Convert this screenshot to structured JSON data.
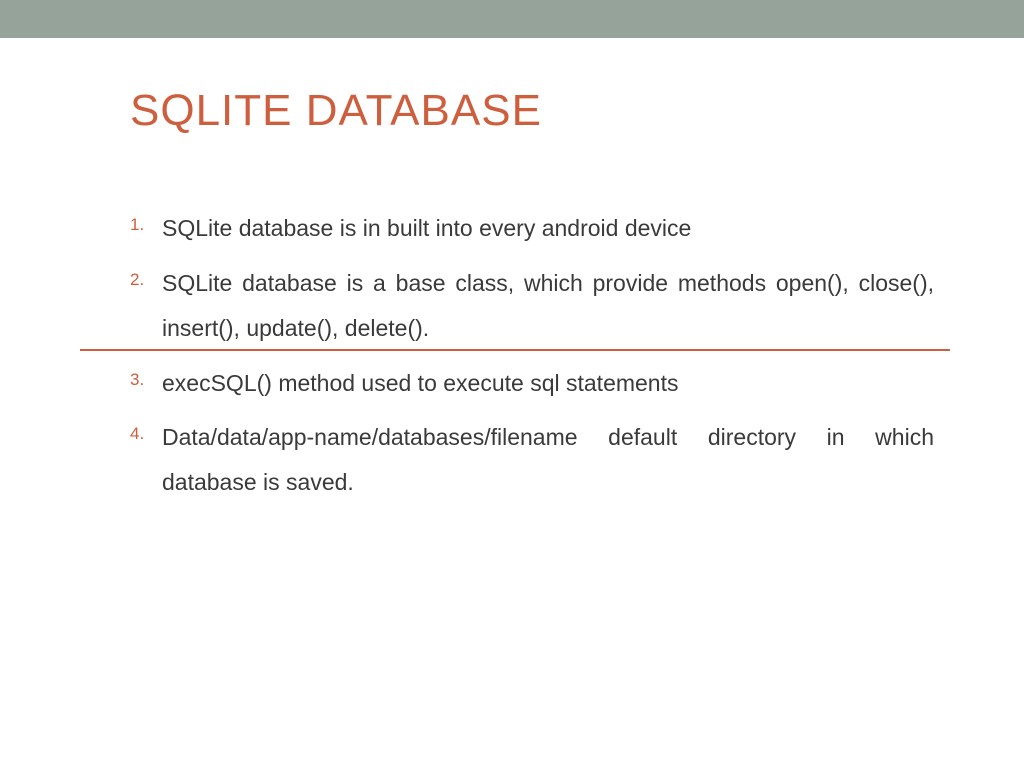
{
  "colors": {
    "accent": "#cd5f3e",
    "topbar": "#95a39b",
    "body_text": "#3a3a3a"
  },
  "title": "SQLITE DATABASE",
  "items": [
    "SQLite database is in built into every android device",
    "SQLite database is a base class, which provide methods open(), close(), insert(), update(), delete().",
    "execSQL() method used to execute sql statements",
    "Data/data/app-name/databases/filename default directory in which database is saved."
  ]
}
